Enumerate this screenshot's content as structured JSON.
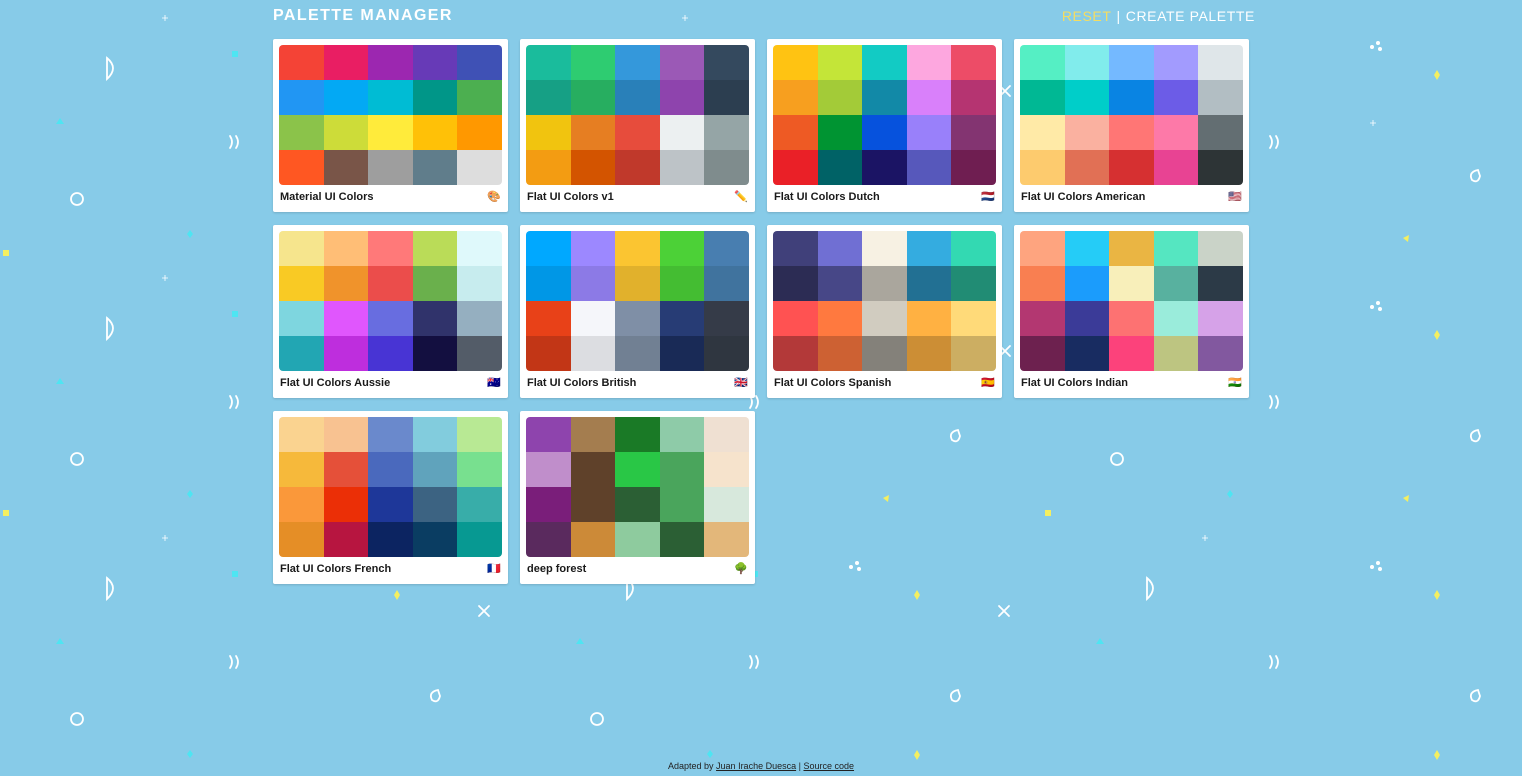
{
  "header": {
    "title": "PALETTE MANAGER",
    "reset_label": "RESET",
    "separator": "|",
    "create_label": "CREATE PALETTE"
  },
  "palettes": [
    {
      "name": "Material UI Colors",
      "emoji": "🎨",
      "emoji_icon": "artist-palette-icon",
      "colors": [
        "#f44336",
        "#e91e63",
        "#9c27b0",
        "#673ab7",
        "#3f51b5",
        "#2196f3",
        "#03a9f4",
        "#00bcd4",
        "#009688",
        "#4caf50",
        "#8bc34a",
        "#cddc39",
        "#ffeb3b",
        "#ffc107",
        "#ff9800",
        "#ff5722",
        "#795548",
        "#9e9e9e",
        "#607d8b",
        "#dddddd"
      ]
    },
    {
      "name": "Flat UI Colors v1",
      "emoji": "✏️",
      "emoji_icon": "pencil-icon",
      "colors": [
        "#1abc9c",
        "#2ecc71",
        "#3498db",
        "#9b59b6",
        "#34495e",
        "#16a085",
        "#27ae60",
        "#2980b9",
        "#8e44ad",
        "#2c3e50",
        "#f1c40f",
        "#e67e22",
        "#e74c3c",
        "#ecf0f1",
        "#95a5a6",
        "#f39c12",
        "#d35400",
        "#c0392b",
        "#bdc3c7",
        "#7f8c8d"
      ]
    },
    {
      "name": "Flat UI Colors Dutch",
      "emoji": "🇳🇱",
      "emoji_icon": "netherlands-flag-icon",
      "colors": [
        "#ffc312",
        "#c4e538",
        "#12cbc4",
        "#fda7df",
        "#ed4c67",
        "#f79f1f",
        "#a3cb38",
        "#1289a7",
        "#d980fa",
        "#b53471",
        "#ee5a24",
        "#009432",
        "#0652dd",
        "#9980fa",
        "#833471",
        "#ea2027",
        "#006266",
        "#1b1464",
        "#5758bb",
        "#6f1e51"
      ]
    },
    {
      "name": "Flat UI Colors American",
      "emoji": "🇺🇸",
      "emoji_icon": "usa-flag-icon",
      "colors": [
        "#55efc4",
        "#81ecec",
        "#74b9ff",
        "#a29bfe",
        "#dfe6e9",
        "#00b894",
        "#00cec9",
        "#0984e3",
        "#6c5ce7",
        "#b2bec3",
        "#ffeaa7",
        "#fab1a0",
        "#ff7675",
        "#fd79a8",
        "#636e72",
        "#fdcb6e",
        "#e17055",
        "#d63031",
        "#e84393",
        "#2d3436"
      ]
    },
    {
      "name": "Flat UI Colors Aussie",
      "emoji": "🇦🇺",
      "emoji_icon": "australia-flag-icon",
      "colors": [
        "#f6e58d",
        "#ffbe76",
        "#ff7979",
        "#badc58",
        "#dff9fb",
        "#f9ca24",
        "#f0932b",
        "#eb4d4b",
        "#6ab04c",
        "#c7ecee",
        "#7ed6df",
        "#e056fd",
        "#686de0",
        "#30336b",
        "#95afc0",
        "#22a6b3",
        "#be2edd",
        "#4834d4",
        "#130f40",
        "#535c68"
      ]
    },
    {
      "name": "Flat UI Colors British",
      "emoji": "🇬🇧",
      "emoji_icon": "uk-flag-icon",
      "colors": [
        "#00a8ff",
        "#9c88ff",
        "#fbc531",
        "#4cd137",
        "#487eb0",
        "#0097e6",
        "#8c7ae6",
        "#e1b12c",
        "#44bd32",
        "#40739e",
        "#e84118",
        "#f5f6fa",
        "#7f8fa6",
        "#273c75",
        "#353b48",
        "#c23616",
        "#dcdde1",
        "#718093",
        "#192a56",
        "#2f3640"
      ]
    },
    {
      "name": "Flat UI Colors Spanish",
      "emoji": "🇪🇸",
      "emoji_icon": "spain-flag-icon",
      "colors": [
        "#40407a",
        "#706fd3",
        "#f7f1e3",
        "#34ace0",
        "#33d9b2",
        "#2c2c54",
        "#474787",
        "#aaa69d",
        "#227093",
        "#218c74",
        "#ff5252",
        "#ff793f",
        "#d1ccc0",
        "#ffb142",
        "#ffda79",
        "#b33939",
        "#cd6133",
        "#84817a",
        "#cc8e35",
        "#ccae62"
      ]
    },
    {
      "name": "Flat UI Colors Indian",
      "emoji": "🇮🇳",
      "emoji_icon": "india-flag-icon",
      "colors": [
        "#fea47f",
        "#25ccf7",
        "#eab543",
        "#55e6c1",
        "#cad3c8",
        "#f97f51",
        "#1b9cfc",
        "#f8efba",
        "#58b19f",
        "#2c3a47",
        "#b33771",
        "#3b3b98",
        "#fd7272",
        "#9aecdb",
        "#d6a2e8",
        "#6d214f",
        "#182c61",
        "#fc427b",
        "#bdc581",
        "#82589f"
      ]
    },
    {
      "name": "Flat UI Colors French",
      "emoji": "🇫🇷",
      "emoji_icon": "france-flag-icon",
      "colors": [
        "#fad390",
        "#f8c291",
        "#6a89cc",
        "#82ccdd",
        "#b8e994",
        "#f6b93b",
        "#e55039",
        "#4a69bd",
        "#60a3bc",
        "#78e08f",
        "#fa983a",
        "#eb2f06",
        "#1e3799",
        "#3c6382",
        "#38ada9",
        "#e58e26",
        "#b71540",
        "#0c2461",
        "#0a3d62",
        "#079992"
      ]
    },
    {
      "name": "deep forest",
      "emoji": "🌳",
      "emoji_icon": "tree-icon",
      "colors": [
        "#8e44ad",
        "#a47d4f",
        "#1a7a26",
        "#8ecba8",
        "#efe0d2",
        "#c08ecb",
        "#5f412a",
        "#29c746",
        "#4aa55c",
        "#f6e3cc",
        "#7a1e7a",
        "#5f412a",
        "#2b5f34",
        "#4aa55c",
        "#d7e8dc",
        "#5a2a5e",
        "#cc8a38",
        "#8ecb9e",
        "#2b5f34",
        "#e3b77a"
      ]
    }
  ],
  "footer": {
    "prefix": "Adapted by",
    "author_link": "Juan Irache Duesca",
    "separator": "|",
    "source_link": "Source code"
  }
}
